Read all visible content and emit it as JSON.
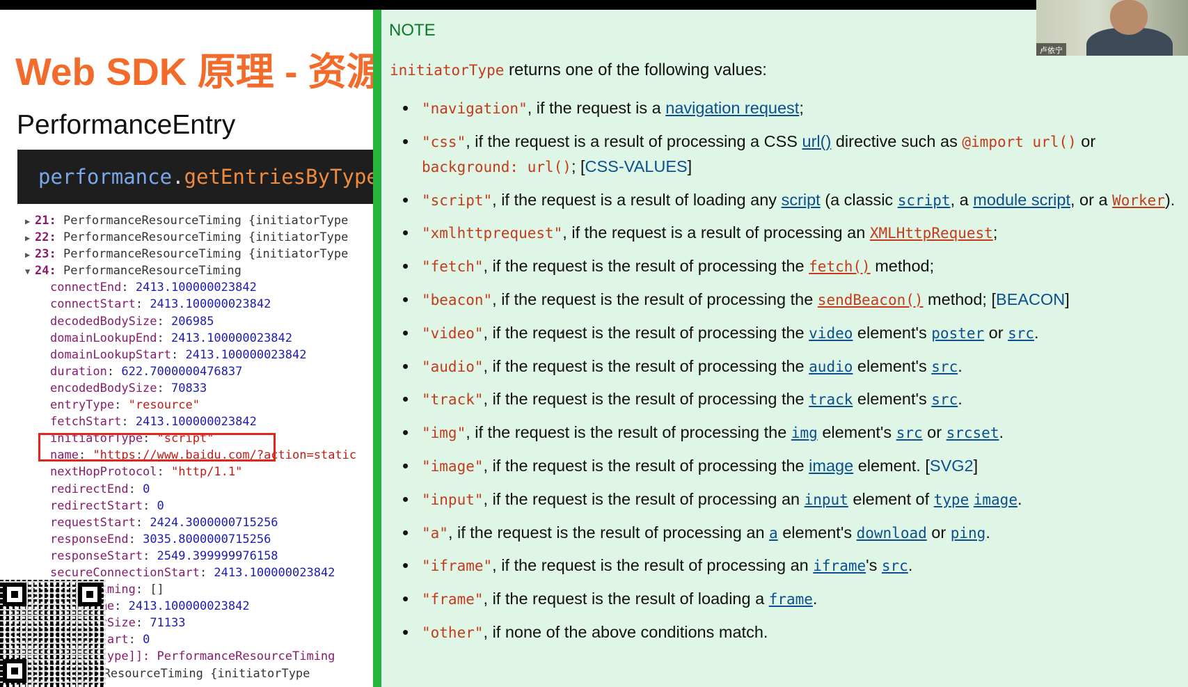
{
  "slide": {
    "title": "Web SDK 原理 - 资源",
    "subtitle": "PerformanceEntry",
    "code": {
      "object": "performance",
      "dot": ".",
      "method": "getEntriesByType"
    },
    "collapsed_rows": [
      {
        "index": "21:",
        "text": " PerformanceResourceTiming {initiatorType"
      },
      {
        "index": "22:",
        "text": " PerformanceResourceTiming {initiatorType"
      },
      {
        "index": "23:",
        "text": " PerformanceResourceTiming {initiatorType"
      }
    ],
    "expanded_row": {
      "index": "24:",
      "text": " PerformanceResourceTiming"
    },
    "properties": [
      {
        "key": "connectEnd",
        "value": "2413.100000023842",
        "type": "num"
      },
      {
        "key": "connectStart",
        "value": "2413.100000023842",
        "type": "num"
      },
      {
        "key": "decodedBodySize",
        "value": "206985",
        "type": "num"
      },
      {
        "key": "domainLookupEnd",
        "value": "2413.100000023842",
        "type": "num"
      },
      {
        "key": "domainLookupStart",
        "value": "2413.100000023842",
        "type": "num"
      },
      {
        "key": "duration",
        "value": "622.7000000476837",
        "type": "num"
      },
      {
        "key": "encodedBodySize",
        "value": "70833",
        "type": "num"
      },
      {
        "key": "entryType",
        "value": "\"resource\"",
        "type": "str"
      },
      {
        "key": "fetchStart",
        "value": "2413.100000023842",
        "type": "num"
      },
      {
        "key": "initiatorType",
        "value": "\"script\"",
        "type": "str"
      },
      {
        "key": "name",
        "value": "\"https://www.baidu.com/?action=static",
        "type": "str"
      },
      {
        "key": "nextHopProtocol",
        "value": "\"http/1.1\"",
        "type": "str"
      },
      {
        "key": "redirectEnd",
        "value": "0",
        "type": "num"
      },
      {
        "key": "redirectStart",
        "value": "0",
        "type": "num"
      },
      {
        "key": "requestStart",
        "value": "2424.3000000715256",
        "type": "num"
      },
      {
        "key": "responseEnd",
        "value": "3035.8000000715256",
        "type": "num"
      },
      {
        "key": "responseStart",
        "value": "2549.399999976158",
        "type": "num"
      },
      {
        "key": "secureConnectionStart",
        "value": "2413.100000023842",
        "type": "num"
      },
      {
        "key": "serverTiming",
        "value": "[]",
        "type": "plain"
      },
      {
        "key": "startTime",
        "value": "2413.100000023842",
        "type": "num"
      },
      {
        "key": "transferSize",
        "value": "71133",
        "type": "num"
      },
      {
        "key": "workerStart",
        "value": "0",
        "type": "num"
      }
    ],
    "proto_row": "[[Prototype]]: PerformanceResourceTiming",
    "last_row": "PerformanceResourceTiming {initiatorType"
  },
  "note": {
    "label": "NOTE",
    "intro_code": "initiatorType",
    "intro_text": " returns one of the following values:",
    "items": [
      [
        {
          "t": "c",
          "v": "\"navigation\""
        },
        {
          "t": "x",
          "v": ", if the request is a "
        },
        {
          "t": "l",
          "v": "navigation request"
        },
        {
          "t": "x",
          "v": ";"
        }
      ],
      [
        {
          "t": "c",
          "v": "\"css\""
        },
        {
          "t": "x",
          "v": ", if the request is a result of processing a CSS "
        },
        {
          "t": "l",
          "v": "url()"
        },
        {
          "t": "x",
          "v": " directive such as "
        },
        {
          "t": "c",
          "v": "@import url()"
        },
        {
          "t": "x",
          "v": " or "
        },
        {
          "t": "c",
          "v": "background: url()"
        },
        {
          "t": "x",
          "v": "; ["
        },
        {
          "t": "r",
          "v": "CSS-VALUES"
        },
        {
          "t": "x",
          "v": "]"
        }
      ],
      [
        {
          "t": "c",
          "v": "\"script\""
        },
        {
          "t": "x",
          "v": ", if the request is a result of loading any "
        },
        {
          "t": "l",
          "v": "script"
        },
        {
          "t": "x",
          "v": " (a classic "
        },
        {
          "t": "m",
          "v": "script"
        },
        {
          "t": "x",
          "v": ", a "
        },
        {
          "t": "l",
          "v": "module script"
        },
        {
          "t": "x",
          "v": ", or a "
        },
        {
          "t": "o",
          "v": "Worker"
        },
        {
          "t": "x",
          "v": ")."
        }
      ],
      [
        {
          "t": "c",
          "v": "\"xmlhttprequest\""
        },
        {
          "t": "x",
          "v": ", if the request is a result of processing an "
        },
        {
          "t": "o",
          "v": "XMLHttpRequest"
        },
        {
          "t": "x",
          "v": ";"
        }
      ],
      [
        {
          "t": "c",
          "v": "\"fetch\""
        },
        {
          "t": "x",
          "v": ", if the request is the result of processing the "
        },
        {
          "t": "o",
          "v": "fetch()"
        },
        {
          "t": "x",
          "v": " method;"
        }
      ],
      [
        {
          "t": "c",
          "v": "\"beacon\""
        },
        {
          "t": "x",
          "v": ", if the request is the result of processing the "
        },
        {
          "t": "o",
          "v": "sendBeacon()"
        },
        {
          "t": "x",
          "v": " method; ["
        },
        {
          "t": "r",
          "v": "BEACON"
        },
        {
          "t": "x",
          "v": "]"
        }
      ],
      [
        {
          "t": "c",
          "v": "\"video\""
        },
        {
          "t": "x",
          "v": ", if the request is the result of processing the "
        },
        {
          "t": "m",
          "v": "video"
        },
        {
          "t": "x",
          "v": " element's "
        },
        {
          "t": "m",
          "v": "poster"
        },
        {
          "t": "x",
          "v": " or "
        },
        {
          "t": "m",
          "v": "src"
        },
        {
          "t": "x",
          "v": "."
        }
      ],
      [
        {
          "t": "c",
          "v": "\"audio\""
        },
        {
          "t": "x",
          "v": ", if the request is the result of processing the "
        },
        {
          "t": "m",
          "v": "audio"
        },
        {
          "t": "x",
          "v": " element's "
        },
        {
          "t": "m",
          "v": "src"
        },
        {
          "t": "x",
          "v": "."
        }
      ],
      [
        {
          "t": "c",
          "v": "\"track\""
        },
        {
          "t": "x",
          "v": ", if the request is the result of processing the "
        },
        {
          "t": "m",
          "v": "track"
        },
        {
          "t": "x",
          "v": " element's "
        },
        {
          "t": "m",
          "v": "src"
        },
        {
          "t": "x",
          "v": "."
        }
      ],
      [
        {
          "t": "c",
          "v": "\"img\""
        },
        {
          "t": "x",
          "v": ", if the request is the result of processing the "
        },
        {
          "t": "m",
          "v": "img"
        },
        {
          "t": "x",
          "v": " element's "
        },
        {
          "t": "m",
          "v": "src"
        },
        {
          "t": "x",
          "v": " or "
        },
        {
          "t": "m",
          "v": "srcset"
        },
        {
          "t": "x",
          "v": "."
        }
      ],
      [
        {
          "t": "c",
          "v": "\"image\""
        },
        {
          "t": "x",
          "v": ", if the request is the result of processing the "
        },
        {
          "t": "l",
          "v": "image"
        },
        {
          "t": "x",
          "v": " element. ["
        },
        {
          "t": "r",
          "v": "SVG2"
        },
        {
          "t": "x",
          "v": "]"
        }
      ],
      [
        {
          "t": "c",
          "v": "\"input\""
        },
        {
          "t": "x",
          "v": ", if the request is the result of processing an "
        },
        {
          "t": "m",
          "v": "input"
        },
        {
          "t": "x",
          "v": " element of "
        },
        {
          "t": "m",
          "v": "type"
        },
        {
          "t": "x",
          "v": " "
        },
        {
          "t": "m",
          "v": "image"
        },
        {
          "t": "x",
          "v": "."
        }
      ],
      [
        {
          "t": "c",
          "v": "\"a\""
        },
        {
          "t": "x",
          "v": ", if the request is the result of processing an "
        },
        {
          "t": "m",
          "v": "a"
        },
        {
          "t": "x",
          "v": " element's "
        },
        {
          "t": "m",
          "v": "download"
        },
        {
          "t": "x",
          "v": " or "
        },
        {
          "t": "m",
          "v": "ping"
        },
        {
          "t": "x",
          "v": "."
        }
      ],
      [
        {
          "t": "c",
          "v": "\"iframe\""
        },
        {
          "t": "x",
          "v": ", if the request is the result of processing an "
        },
        {
          "t": "m",
          "v": "iframe"
        },
        {
          "t": "x",
          "v": "'s "
        },
        {
          "t": "m",
          "v": "src"
        },
        {
          "t": "x",
          "v": "."
        }
      ],
      [
        {
          "t": "c",
          "v": "\"frame\""
        },
        {
          "t": "x",
          "v": ", if the request is the result of loading a "
        },
        {
          "t": "m",
          "v": "frame"
        },
        {
          "t": "x",
          "v": "."
        }
      ],
      [
        {
          "t": "c",
          "v": "\"other\""
        },
        {
          "t": "x",
          "v": ", if none of the above conditions match."
        }
      ]
    ]
  },
  "webcam": {
    "name": "卢依宁"
  }
}
